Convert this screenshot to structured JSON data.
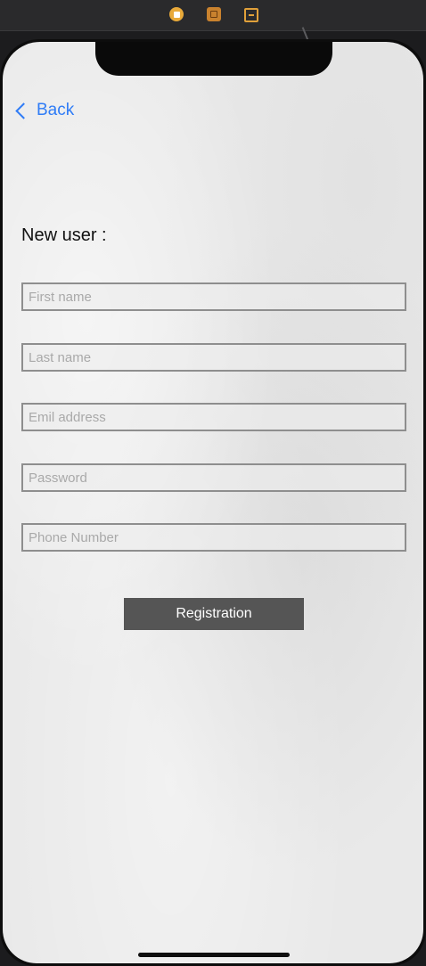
{
  "toolbar": {
    "icons": [
      "stop-icon",
      "box-icon",
      "exit-icon"
    ]
  },
  "nav": {
    "back_label": "Back"
  },
  "form": {
    "title": "New user :",
    "fields": [
      {
        "name": "first-name",
        "value": "",
        "placeholder": "First name"
      },
      {
        "name": "last-name",
        "value": "",
        "placeholder": "Last name"
      },
      {
        "name": "email",
        "value": "",
        "placeholder": "Emil address"
      },
      {
        "name": "password",
        "value": "",
        "placeholder": "Password"
      },
      {
        "name": "phone",
        "value": "",
        "placeholder": "Phone Number"
      }
    ],
    "submit_label": "Registration"
  },
  "colors": {
    "accent": "#2f7cf6",
    "button_bg": "#555555",
    "field_border": "#8e8e8e"
  }
}
